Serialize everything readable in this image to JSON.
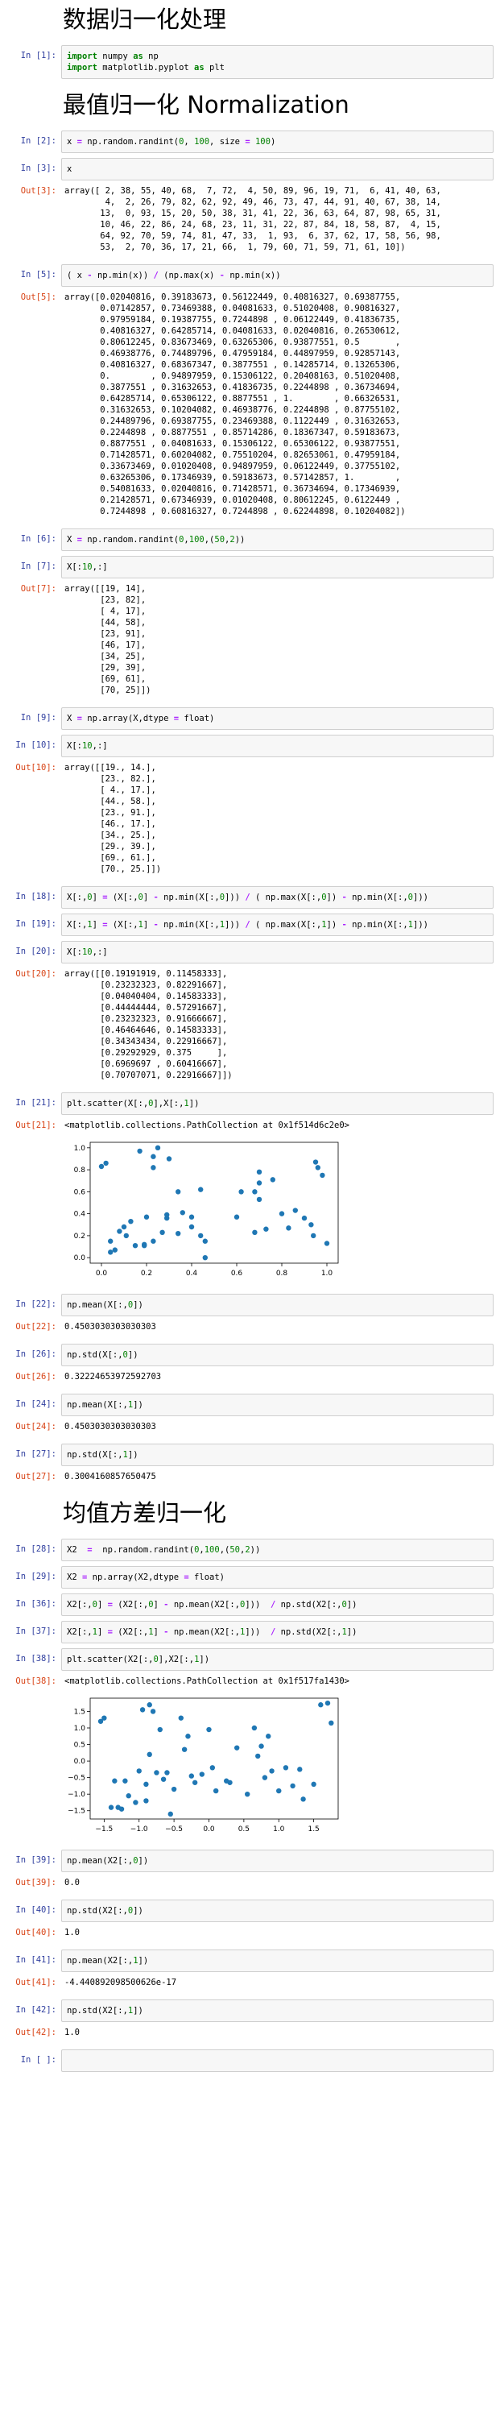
{
  "headings": {
    "h1": "数据归一化处理",
    "h2": "最值归一化 Normalization",
    "h3": "均值方差归一化"
  },
  "cells": [
    {
      "prompt_in": "In [1]:",
      "code_lines": [
        "import numpy as np",
        "import matplotlib.pyplot as plt"
      ]
    },
    {
      "prompt_in": "In [2]:",
      "code": "x = np.random.randint(0, 100, size = 100)"
    },
    {
      "prompt_in": "In [3]:",
      "code": "x",
      "prompt_out": "Out[3]:",
      "output": "array([ 2, 38, 55, 40, 68,  7, 72,  4, 50, 89, 96, 19, 71,  6, 41, 40, 63,\n        4,  2, 26, 79, 82, 62, 92, 49, 46, 73, 47, 44, 91, 40, 67, 38, 14,\n       13,  0, 93, 15, 20, 50, 38, 31, 41, 22, 36, 63, 64, 87, 98, 65, 31,\n       10, 46, 22, 86, 24, 68, 23, 11, 31, 22, 87, 84, 18, 58, 87,  4, 15,\n       64, 92, 70, 59, 74, 81, 47, 33,  1, 93,  6, 37, 62, 17, 58, 56, 98,\n       53,  2, 70, 36, 17, 21, 66,  1, 79, 60, 71, 59, 71, 61, 10])"
    },
    {
      "prompt_in": "In [5]:",
      "code": "( x - np.min(x)) / (np.max(x) - np.min(x))",
      "prompt_out": "Out[5]:",
      "output": "array([0.02040816, 0.39183673, 0.56122449, 0.40816327, 0.69387755,\n       0.07142857, 0.73469388, 0.04081633, 0.51020408, 0.90816327,\n       0.97959184, 0.19387755, 0.7244898 , 0.06122449, 0.41836735,\n       0.40816327, 0.64285714, 0.04081633, 0.02040816, 0.26530612,\n       0.80612245, 0.83673469, 0.63265306, 0.93877551, 0.5       ,\n       0.46938776, 0.74489796, 0.47959184, 0.44897959, 0.92857143,\n       0.40816327, 0.68367347, 0.3877551 , 0.14285714, 0.13265306,\n       0.        , 0.94897959, 0.15306122, 0.20408163, 0.51020408,\n       0.3877551 , 0.31632653, 0.41836735, 0.2244898 , 0.36734694,\n       0.64285714, 0.65306122, 0.8877551 , 1.        , 0.66326531,\n       0.31632653, 0.10204082, 0.46938776, 0.2244898 , 0.87755102,\n       0.24489796, 0.69387755, 0.23469388, 0.1122449 , 0.31632653,\n       0.2244898 , 0.8877551 , 0.85714286, 0.18367347, 0.59183673,\n       0.8877551 , 0.04081633, 0.15306122, 0.65306122, 0.93877551,\n       0.71428571, 0.60204082, 0.75510204, 0.82653061, 0.47959184,\n       0.33673469, 0.01020408, 0.94897959, 0.06122449, 0.37755102,\n       0.63265306, 0.17346939, 0.59183673, 0.57142857, 1.        ,\n       0.54081633, 0.02040816, 0.71428571, 0.36734694, 0.17346939,\n       0.21428571, 0.67346939, 0.01020408, 0.80612245, 0.6122449 ,\n       0.7244898 , 0.60816327, 0.7244898 , 0.62244898, 0.10204082])"
    },
    {
      "prompt_in": "In [6]:",
      "code": "X = np.random.randint(0,100,(50,2))"
    },
    {
      "prompt_in": "In [7]:",
      "code": "X[:10,:]",
      "prompt_out": "Out[7]:",
      "output": "array([[19, 14],\n       [23, 82],\n       [ 4, 17],\n       [44, 58],\n       [23, 91],\n       [46, 17],\n       [34, 25],\n       [29, 39],\n       [69, 61],\n       [70, 25]])"
    },
    {
      "prompt_in": "In [9]:",
      "code": "X = np.array(X,dtype = float)"
    },
    {
      "prompt_in": "In [10]:",
      "code": "X[:10,:]",
      "prompt_out": "Out[10]:",
      "output": "array([[19., 14.],\n       [23., 82.],\n       [ 4., 17.],\n       [44., 58.],\n       [23., 91.],\n       [46., 17.],\n       [34., 25.],\n       [29., 39.],\n       [69., 61.],\n       [70., 25.]])"
    },
    {
      "prompt_in": "In [18]:",
      "code": "X[:,0] = (X[:,0] - np.min(X[:,0])) / ( np.max(X[:,0]) - np.min(X[:,0]))"
    },
    {
      "prompt_in": "In [19]:",
      "code": "X[:,1] = (X[:,1] - np.min(X[:,1])) / ( np.max(X[:,1]) - np.min(X[:,1]))"
    },
    {
      "prompt_in": "In [20]:",
      "code": "X[:10,:]",
      "prompt_out": "Out[20]:",
      "output": "array([[0.19191919, 0.11458333],\n       [0.23232323, 0.82291667],\n       [0.04040404, 0.14583333],\n       [0.44444444, 0.57291667],\n       [0.23232323, 0.91666667],\n       [0.46464646, 0.14583333],\n       [0.34343434, 0.22916667],\n       [0.29292929, 0.375     ],\n       [0.6969697 , 0.60416667],\n       [0.70707071, 0.22916667]])"
    },
    {
      "prompt_in": "In [21]:",
      "code": "plt.scatter(X[:,0],X[:,1])",
      "prompt_out": "Out[21]:",
      "output": "<matplotlib.collections.PathCollection at 0x1f514d6c2e0>"
    },
    {
      "prompt_in": "In [22]:",
      "code": "np.mean(X[:,0])",
      "prompt_out": "Out[22]:",
      "output": "0.4503030303030303"
    },
    {
      "prompt_in": "In [26]:",
      "code": "np.std(X[:,0])",
      "prompt_out": "Out[26]:",
      "output": "0.32224653972592703"
    },
    {
      "prompt_in": "In [24]:",
      "code": "np.mean(X[:,1])",
      "prompt_out": "Out[24]:",
      "output": "0.4503030303030303"
    },
    {
      "prompt_in": "In [27]:",
      "code": "np.std(X[:,1])",
      "prompt_out": "Out[27]:",
      "output": "0.3004160857650475"
    },
    {
      "prompt_in": "In [28]:",
      "code": "X2  =  np.random.randint(0,100,(50,2))"
    },
    {
      "prompt_in": "In [29]:",
      "code": "X2 = np.array(X2,dtype = float)"
    },
    {
      "prompt_in": "In [36]:",
      "code": "X2[:,0] = (X2[:,0] - np.mean(X2[:,0]))  / np.std(X2[:,0])"
    },
    {
      "prompt_in": "In [37]:",
      "code": "X2[:,1] = (X2[:,1] - np.mean(X2[:,1]))  / np.std(X2[:,1])"
    },
    {
      "prompt_in": "In [38]:",
      "code": "plt.scatter(X2[:,0],X2[:,1])",
      "prompt_out": "Out[38]:",
      "output": "<matplotlib.collections.PathCollection at 0x1f517fa1430>"
    },
    {
      "prompt_in": "In [39]:",
      "code": "np.mean(X2[:,0])",
      "prompt_out": "Out[39]:",
      "output": "0.0"
    },
    {
      "prompt_in": "In [40]:",
      "code": "np.std(X2[:,0])",
      "prompt_out": "Out[40]:",
      "output": "1.0"
    },
    {
      "prompt_in": "In [41]:",
      "code": "np.mean(X2[:,1])",
      "prompt_out": "Out[41]:",
      "output": "-4.440892098500626e-17"
    },
    {
      "prompt_in": "In [42]:",
      "code": "np.std(X2[:,1])",
      "prompt_out": "Out[42]:",
      "output": "1.0"
    },
    {
      "prompt_in": "In [ ]:",
      "code": ""
    }
  ],
  "chart_data": [
    {
      "type": "scatter",
      "xlim": [
        -0.05,
        1.05
      ],
      "ylim": [
        -0.05,
        1.05
      ],
      "xticks": [
        "0.0",
        "0.2",
        "0.4",
        "0.6",
        "0.8",
        "1.0"
      ],
      "yticks": [
        "0.0",
        "0.2",
        "0.4",
        "0.6",
        "0.8",
        "1.0"
      ],
      "color": "#1f77b4",
      "x": [
        0.0,
        0.02,
        0.04,
        0.04,
        0.06,
        0.08,
        0.1,
        0.11,
        0.13,
        0.15,
        0.17,
        0.19,
        0.19,
        0.2,
        0.23,
        0.23,
        0.23,
        0.25,
        0.27,
        0.29,
        0.29,
        0.3,
        0.34,
        0.34,
        0.36,
        0.4,
        0.4,
        0.44,
        0.46,
        0.46,
        0.6,
        0.62,
        0.68,
        0.68,
        0.7,
        0.7,
        0.7,
        0.73,
        0.76,
        0.8,
        0.83,
        0.86,
        0.9,
        0.93,
        0.95,
        0.96,
        0.98,
        1.0,
        0.94,
        0.44
      ],
      "y": [
        0.83,
        0.86,
        0.15,
        0.05,
        0.07,
        0.24,
        0.28,
        0.2,
        0.33,
        0.11,
        0.97,
        0.12,
        0.11,
        0.37,
        0.82,
        0.92,
        0.15,
        1.0,
        0.23,
        0.36,
        0.39,
        0.9,
        0.22,
        0.6,
        0.41,
        0.28,
        0.37,
        0.2,
        0.15,
        0.0,
        0.37,
        0.6,
        0.6,
        0.23,
        0.68,
        0.78,
        0.53,
        0.26,
        0.71,
        0.4,
        0.27,
        0.43,
        0.36,
        0.3,
        0.87,
        0.82,
        0.75,
        0.13,
        0.2,
        0.62
      ]
    },
    {
      "type": "scatter",
      "xlim": [
        -1.7,
        1.85
      ],
      "ylim": [
        -1.75,
        1.9
      ],
      "xticks": [
        "−1.5",
        "−1.0",
        "−0.5",
        "0.0",
        "0.5",
        "1.0",
        "1.5"
      ],
      "yticks": [
        "−1.5",
        "−1.0",
        "−0.5",
        "0.0",
        "0.5",
        "1.0",
        "1.5"
      ],
      "color": "#1f77b4",
      "x": [
        -1.55,
        -1.5,
        -1.35,
        -1.3,
        -1.25,
        -1.2,
        -1.15,
        -1.05,
        -1.0,
        -0.95,
        -0.9,
        -0.9,
        -0.85,
        -0.8,
        -0.75,
        -0.7,
        -0.65,
        -0.6,
        -0.55,
        -0.5,
        -0.4,
        -0.35,
        -0.3,
        -0.25,
        -0.2,
        -0.1,
        0.0,
        0.05,
        0.1,
        0.25,
        0.4,
        0.55,
        0.65,
        0.7,
        0.75,
        0.8,
        0.85,
        0.9,
        1.0,
        1.1,
        1.2,
        1.3,
        1.35,
        1.5,
        1.6,
        1.7,
        1.75,
        -0.85,
        0.3,
        -1.4
      ],
      "y": [
        1.2,
        1.3,
        -0.6,
        -1.4,
        -1.45,
        -0.6,
        -1.05,
        -1.25,
        -0.3,
        1.55,
        -0.7,
        -1.2,
        1.7,
        1.5,
        -0.35,
        0.95,
        -0.55,
        -0.35,
        -1.6,
        -0.85,
        1.3,
        0.35,
        0.75,
        -0.45,
        -0.65,
        -0.4,
        0.95,
        -0.2,
        -0.9,
        -0.6,
        0.4,
        -1.0,
        1.0,
        0.15,
        0.45,
        -0.5,
        0.75,
        -0.3,
        -0.9,
        -0.2,
        -0.75,
        -0.25,
        -1.15,
        -0.7,
        1.7,
        1.75,
        1.15,
        0.2,
        -0.65,
        -1.4
      ]
    }
  ]
}
